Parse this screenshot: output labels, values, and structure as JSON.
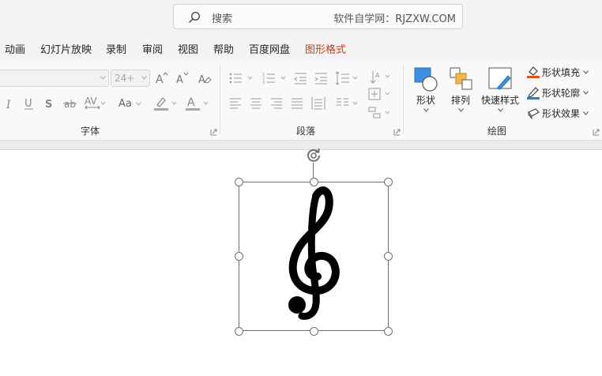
{
  "search": {
    "placeholder": "搜索",
    "watermark": "软件自学网：RJZXW.COM"
  },
  "menu": {
    "items": [
      {
        "label": "动画"
      },
      {
        "label": "幻灯片放映"
      },
      {
        "label": "录制"
      },
      {
        "label": "审阅"
      },
      {
        "label": "视图"
      },
      {
        "label": "帮助"
      },
      {
        "label": "百度网盘"
      },
      {
        "label": "图形格式",
        "active": true
      }
    ]
  },
  "ribbon": {
    "font_group": {
      "label": "字体",
      "font_size_value": "24+",
      "case_label": "Aa"
    },
    "paragraph_group": {
      "label": "段落"
    },
    "drawing_group": {
      "label": "绘图",
      "shapes_label": "形状",
      "arrange_label": "排列",
      "quick_styles_label": "快速样式",
      "shape_fill_label": "形状填充",
      "shape_outline_label": "形状轮廓",
      "shape_effects_label": "形状效果"
    }
  },
  "colors": {
    "active_tab": "#c43e1c",
    "highlight_bar": "#a6a6a6",
    "font_color_bar": "#a6a6a6",
    "fill_accent": "#e1501e",
    "outline_accent": "#2b7cd3"
  }
}
